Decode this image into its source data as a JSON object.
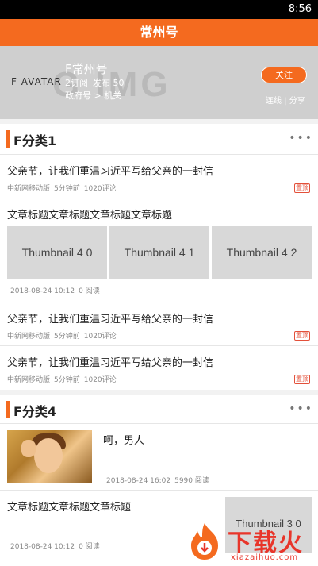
{
  "status_bar": {
    "time": "8:56"
  },
  "app_bar": {
    "title": "常州号"
  },
  "profile": {
    "background_text": "G IMG",
    "avatar_text": "F AVATAR",
    "name": "F常州号",
    "subscriptions": "2订阅",
    "posts": "发布 50",
    "category": "政府号 > 机关",
    "follow_label": "关注",
    "links": "连线 | 分享"
  },
  "sections": [
    {
      "title": "F分类1",
      "more": "•••",
      "items": [
        {
          "title": "父亲节，让我们重温习近平写给父亲的一封信",
          "source": "中新网移动版",
          "time": "5分钟前",
          "comments": "1020评论",
          "tag": "置顶"
        },
        {
          "title": "文章标题文章标题文章标题文章标题",
          "thumbnails": [
            "Thumbnail 4 0",
            "Thumbnail 4 1",
            "Thumbnail 4 2"
          ],
          "date": "2018-08-24 10:12",
          "reads": "0 阅读"
        },
        {
          "title": "父亲节，让我们重温习近平写给父亲的一封信",
          "source": "中新网移动版",
          "time": "5分钟前",
          "comments": "1020评论",
          "tag": "置顶"
        },
        {
          "title": "父亲节，让我们重温习近平写给父亲的一封信",
          "source": "中新网移动版",
          "time": "5分钟前",
          "comments": "1020评论",
          "tag": "置顶"
        }
      ]
    },
    {
      "title": "F分类4",
      "more": "•••",
      "items": [
        {
          "title": "呵，男人",
          "date": "2018-08-24 16:02",
          "reads": "5990 阅读"
        },
        {
          "title": "文章标题文章标题文章标题",
          "thumbnail": "Thumbnail 3 0",
          "date": "2018-08-24 10:12",
          "reads": "0 阅读"
        }
      ]
    }
  ],
  "watermark": {
    "brand": "下载火",
    "domain": "xiazaihuo.com"
  },
  "colors": {
    "accent": "#f46a1f",
    "tag": "#e3503a",
    "watermark": "#e8352a"
  }
}
